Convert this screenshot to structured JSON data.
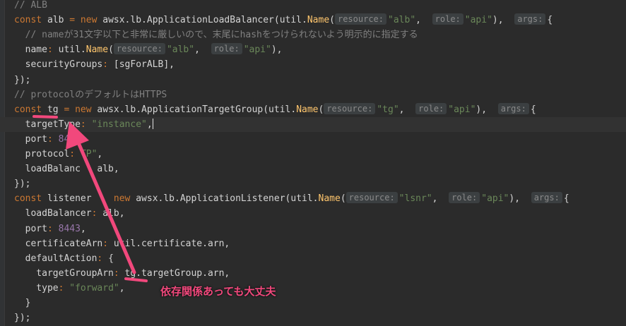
{
  "lines": [
    {
      "segs": [
        {
          "c": "cm",
          "t": "// ALB"
        }
      ]
    },
    {
      "segs": [
        {
          "c": "kw",
          "t": "const "
        },
        {
          "t": "alb "
        },
        {
          "c": "kw",
          "t": "= new "
        },
        {
          "t": "awsx.lb.ApplicationLoadBalancer(util."
        },
        {
          "c": "fn",
          "t": "Name"
        },
        {
          "t": "("
        },
        {
          "h": "resource:"
        },
        {
          "c": "str",
          "t": "\"alb\""
        },
        {
          "t": ",  "
        },
        {
          "h": "role:"
        },
        {
          "c": "str",
          "t": "\"api\""
        },
        {
          "t": "),  "
        },
        {
          "h": "args:"
        },
        {
          "t": "{"
        }
      ]
    },
    {
      "segs": [
        {
          "c": "cm",
          "t": "  // nameが31文字以下と非常に厳しいので、末尾にhashをつけられないよう明示的に指定する"
        }
      ]
    },
    {
      "segs": [
        {
          "t": "  name"
        },
        {
          "c": "kw",
          "t": ": "
        },
        {
          "t": "util."
        },
        {
          "c": "fn",
          "t": "Name"
        },
        {
          "t": "("
        },
        {
          "h": "resource:"
        },
        {
          "c": "str",
          "t": "\"alb\""
        },
        {
          "t": ",  "
        },
        {
          "h": "role:"
        },
        {
          "c": "str",
          "t": "\"api\""
        },
        {
          "t": "),"
        }
      ]
    },
    {
      "segs": [
        {
          "t": "  securityGroups"
        },
        {
          "c": "kw",
          "t": ": "
        },
        {
          "t": "[sgForALB],"
        }
      ]
    },
    {
      "segs": [
        {
          "t": "});"
        }
      ]
    },
    {
      "segs": [
        {
          "c": "cm",
          "t": "// protocolのデフォルトはHTTPS"
        }
      ]
    },
    {
      "segs": [
        {
          "c": "kw",
          "t": "const "
        },
        {
          "t": "tg "
        },
        {
          "c": "kw",
          "t": "= new "
        },
        {
          "t": "awsx.lb.ApplicationTargetGroup(util."
        },
        {
          "c": "fn",
          "t": "Name"
        },
        {
          "t": "("
        },
        {
          "h": "resource:"
        },
        {
          "c": "str",
          "t": "\"tg\""
        },
        {
          "t": ",  "
        },
        {
          "h": "role:"
        },
        {
          "c": "str",
          "t": "\"api\""
        },
        {
          "t": "),  "
        },
        {
          "h": "args:"
        },
        {
          "t": "{"
        }
      ]
    },
    {
      "current": true,
      "segs": [
        {
          "t": "  targetType"
        },
        {
          "c": "kw",
          "t": ": "
        },
        {
          "c": "str",
          "t": "\"instance\""
        },
        {
          "t": ","
        },
        {
          "caret": true
        }
      ]
    },
    {
      "segs": [
        {
          "t": "  port"
        },
        {
          "c": "kw",
          "t": ": "
        },
        {
          "c": "num",
          "t": "844"
        }
      ]
    },
    {
      "segs": [
        {
          "t": "  protocol"
        },
        {
          "c": "kw",
          "t": ": "
        },
        {
          "c": "str",
          "t": "TP\""
        },
        {
          "t": ","
        }
      ]
    },
    {
      "segs": [
        {
          "t": "  loadBalanc"
        },
        {
          "t": "   alb,"
        }
      ]
    },
    {
      "segs": [
        {
          "t": "});"
        }
      ]
    },
    {
      "segs": [
        {
          "c": "kw",
          "t": "const "
        },
        {
          "t": "listener "
        },
        {
          "c": "kw",
          "t": "   new "
        },
        {
          "t": "awsx.lb.ApplicationListener(util."
        },
        {
          "c": "fn",
          "t": "Name"
        },
        {
          "t": "("
        },
        {
          "h": "resource:"
        },
        {
          "c": "str",
          "t": "\"lsnr\""
        },
        {
          "t": ",  "
        },
        {
          "h": "role:"
        },
        {
          "c": "str",
          "t": "\"api\""
        },
        {
          "t": "),  "
        },
        {
          "h": "args:"
        },
        {
          "t": "{"
        }
      ]
    },
    {
      "segs": [
        {
          "t": "  loadBalancer"
        },
        {
          "c": "kw",
          "t": ": "
        },
        {
          "t": "alb,"
        }
      ]
    },
    {
      "segs": [
        {
          "t": "  port"
        },
        {
          "c": "kw",
          "t": ": "
        },
        {
          "c": "num",
          "t": "8443"
        },
        {
          "t": ","
        }
      ]
    },
    {
      "segs": [
        {
          "t": "  certificateArn"
        },
        {
          "c": "kw",
          "t": ": "
        },
        {
          "t": "util.certificate.arn,"
        }
      ]
    },
    {
      "segs": [
        {
          "t": "  defaultAction"
        },
        {
          "c": "kw",
          "t": ": "
        },
        {
          "t": "{"
        }
      ]
    },
    {
      "segs": [
        {
          "t": "    targetGroupArn"
        },
        {
          "c": "kw",
          "t": ": "
        },
        {
          "t": "tg.targetGroup.arn,"
        }
      ]
    },
    {
      "segs": [
        {
          "t": "    type"
        },
        {
          "c": "kw",
          "t": ": "
        },
        {
          "c": "str",
          "t": "\"forward\""
        },
        {
          "t": ","
        }
      ]
    },
    {
      "segs": [
        {
          "t": "  }"
        }
      ]
    },
    {
      "segs": [
        {
          "t": "});"
        }
      ]
    }
  ],
  "annotation": "依存関係あっても大丈夫",
  "colors": {
    "accent": "#f1487c",
    "background": "#2b2b2b"
  }
}
